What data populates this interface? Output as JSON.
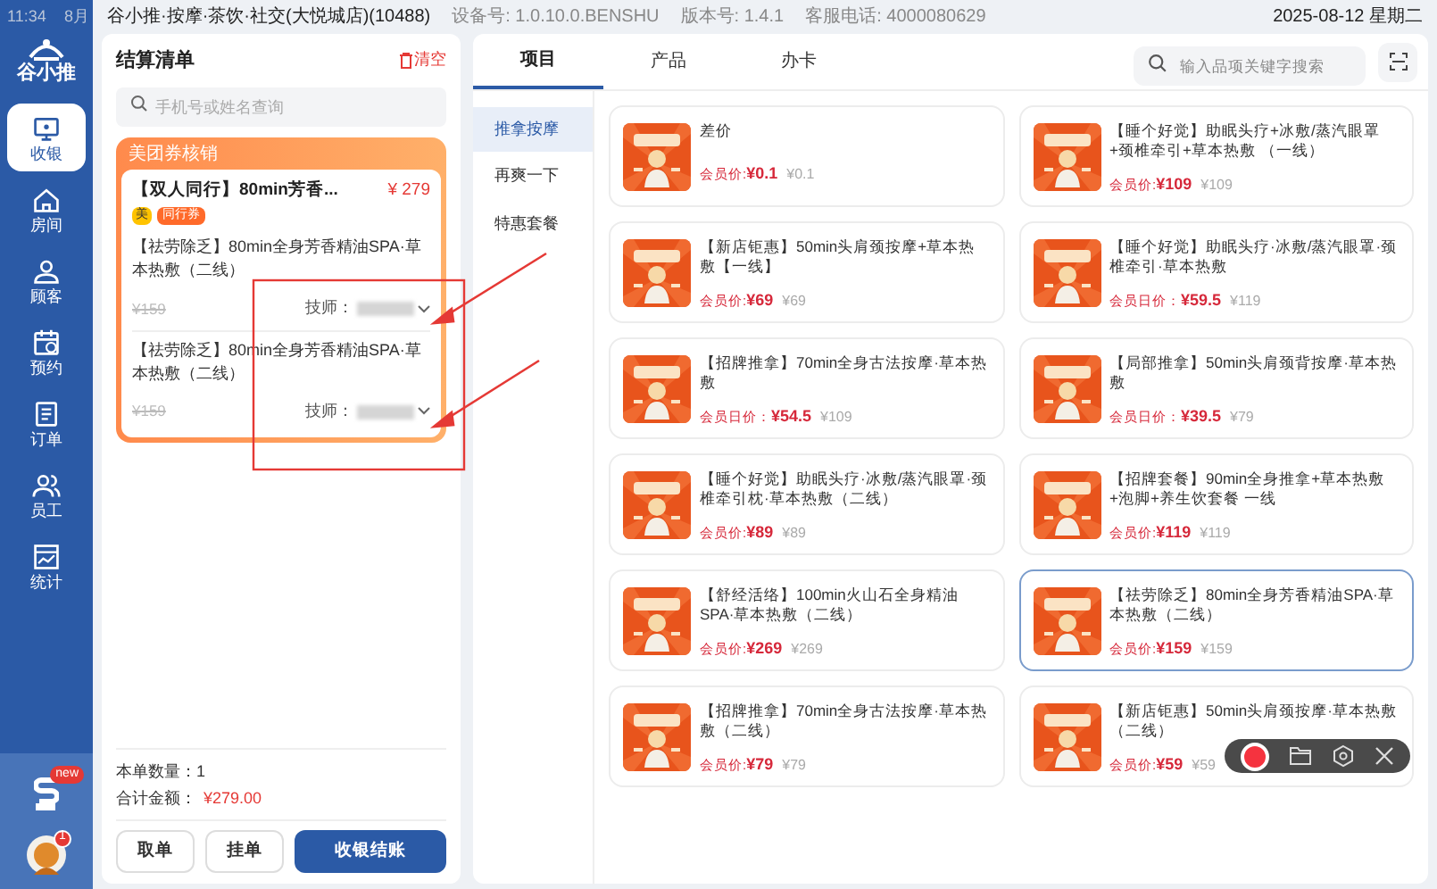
{
  "status_bar": {
    "time": "11:34",
    "date_fragment": "8月",
    "store": "谷小推·按摩·茶饮·社交(大悦城店)(10488)",
    "device": "设备号: 1.0.10.0.BENSHU",
    "version": "版本号: 1.4.1",
    "hotline": "客服电话: 4000080629",
    "datetime": "2025-08-12 星期二"
  },
  "sidebar": {
    "logo": "谷小推",
    "items": [
      {
        "label": "收银",
        "selected": true
      },
      {
        "label": "房间",
        "selected": false
      },
      {
        "label": "顾客",
        "selected": false
      },
      {
        "label": "预约",
        "selected": false
      },
      {
        "label": "订单",
        "selected": false
      },
      {
        "label": "员工",
        "selected": false
      },
      {
        "label": "统计",
        "selected": false
      }
    ],
    "new_badge": "new",
    "avatar_badge": "1"
  },
  "cart": {
    "title": "结算清单",
    "clear": "清空",
    "search": {
      "placeholder": "手机号或姓名查询"
    },
    "coupon": {
      "header": "美团券核销",
      "name": "【双人同行】80min芳香...",
      "price": "¥ 279",
      "tags": [
        {
          "text": "美",
          "kind": "brand"
        },
        {
          "text": "同行券",
          "kind": "type"
        }
      ],
      "items": [
        {
          "name": "【祛劳除乏】80min全身芳香精油SPA·草本热敷（二线）",
          "original_price": "¥159",
          "technician_label": "技师："
        },
        {
          "name": "【祛劳除乏】80min全身芳香精油SPA·草本热敷（二线）",
          "original_price": "¥159",
          "technician_label": "技师："
        }
      ]
    },
    "quantity_label": "本单数量：",
    "quantity": "1",
    "total_label": "合计金额：",
    "total": "¥279.00",
    "buttons": [
      {
        "label": "取单",
        "kind": "secondary"
      },
      {
        "label": "挂单",
        "kind": "secondary"
      },
      {
        "label": "收银结账",
        "kind": "primary"
      }
    ]
  },
  "catalog": {
    "tabs": [
      {
        "label": "项目",
        "selected": true
      },
      {
        "label": "产品",
        "selected": false
      },
      {
        "label": "办卡",
        "selected": false
      }
    ],
    "search": {
      "placeholder": "输入品项关键字搜索"
    },
    "categories": [
      {
        "label": "推拿按摩",
        "selected": true
      },
      {
        "label": "再爽一下",
        "selected": false
      },
      {
        "label": "特惠套餐",
        "selected": false
      }
    ],
    "products": [
      {
        "name": "差价",
        "member_label": "会员价:",
        "member_price": "¥0.1",
        "price": "¥0.1",
        "selected": false
      },
      {
        "name": "【睡个好觉】助眠头疗+冰敷/蒸汽眼罩+颈椎牵引+草本热敷 （一线）",
        "member_label": "会员价:",
        "member_price": "¥109",
        "price": "¥109",
        "selected": false
      },
      {
        "name": "【新店钜惠】50min头肩颈按摩+草本热敷【一线】",
        "member_label": "会员价:",
        "member_price": "¥69",
        "price": "¥69",
        "selected": false
      },
      {
        "name": "【睡个好觉】助眠头疗·冰敷/蒸汽眼罩·颈椎牵引·草本热敷",
        "member_label": "会员日价：",
        "member_price": "¥59.5",
        "price": "¥119",
        "selected": false
      },
      {
        "name": "【招牌推拿】70min全身古法按摩·草本热敷",
        "member_label": "会员日价：",
        "member_price": "¥54.5",
        "price": "¥109",
        "selected": false
      },
      {
        "name": "【局部推拿】50min头肩颈背按摩·草本热敷",
        "member_label": "会员日价：",
        "member_price": "¥39.5",
        "price": "¥79",
        "selected": false
      },
      {
        "name": "【睡个好觉】助眠头疗·冰敷/蒸汽眼罩·颈椎牵引枕·草本热敷（二线）",
        "member_label": "会员价:",
        "member_price": "¥89",
        "price": "¥89",
        "selected": false
      },
      {
        "name": "【招牌套餐】90min全身推拿+草本热敷+泡脚+养生饮套餐 一线",
        "member_label": "会员价:",
        "member_price": "¥119",
        "price": "¥119",
        "selected": false
      },
      {
        "name": "【舒经活络】100min火山石全身精油SPA·草本热敷（二线）",
        "member_label": "会员价:",
        "member_price": "¥269",
        "price": "¥269",
        "selected": false
      },
      {
        "name": "【祛劳除乏】80min全身芳香精油SPA·草本热敷（二线）",
        "member_label": "会员价:",
        "member_price": "¥159",
        "price": "¥159",
        "selected": true
      },
      {
        "name": "【招牌推拿】70min全身古法按摩·草本热敷（二线）",
        "member_label": "会员价:",
        "member_price": "¥79",
        "price": "¥79",
        "selected": false
      },
      {
        "name": "【新店钜惠】50min头肩颈按摩·草本热敷（二线）",
        "member_label": "会员价:",
        "member_price": "¥59",
        "price": "¥59",
        "selected": false
      }
    ]
  }
}
